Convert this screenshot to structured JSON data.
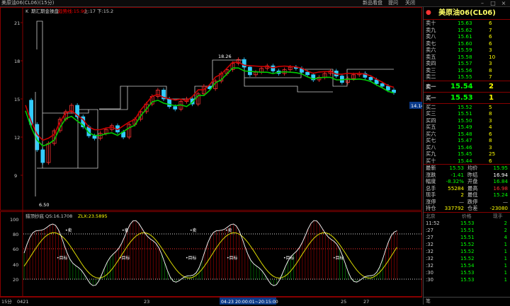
{
  "window": {
    "title": "美原油06(CL06)(15分)",
    "menu": [
      "新品看盘",
      "提问",
      "关闭"
    ]
  },
  "chart_top": {
    "indicator_title": "期汇期金操盘",
    "status_1": "趋势线:15.90",
    "status_2": "上:17 下:15.2",
    "k_label": "K",
    "yticks": [
      "21",
      "18",
      "15",
      "12",
      "9"
    ],
    "high_label": "18.26",
    "low_label": "6.50",
    "price_tag": "14.14"
  },
  "chart_bottom": {
    "indicator_title": "猎顶抄底",
    "qs_label": "QS:16.1708",
    "zlx_label": "ZLX:23.5895",
    "yticks": [
      "100",
      "80",
      "60",
      "40",
      "20"
    ],
    "markers": [
      "•卖",
      "•卖",
      "•卖",
      "•卖",
      "•目标",
      "•目标",
      "•目标",
      "•目标",
      "•目标",
      "•目标"
    ]
  },
  "xaxis": {
    "period": "15分",
    "labels": [
      "0421",
      "23",
      "25",
      "27"
    ],
    "highlight": "04-23 20:00:01~20:15:00"
  },
  "panel": {
    "title": "美原油06(CL06)",
    "asks": [
      {
        "label": "卖十",
        "price": "15.63",
        "vol": "6"
      },
      {
        "label": "卖九",
        "price": "15.62",
        "vol": "7"
      },
      {
        "label": "卖八",
        "price": "15.61",
        "vol": "6"
      },
      {
        "label": "卖七",
        "price": "15.60",
        "vol": "6"
      },
      {
        "label": "卖六",
        "price": "15.59",
        "vol": "3"
      },
      {
        "label": "卖五",
        "price": "15.58",
        "vol": "10"
      },
      {
        "label": "卖四",
        "price": "15.57",
        "vol": "3"
      },
      {
        "label": "卖三",
        "price": "15.56",
        "vol": "8"
      },
      {
        "label": "卖二",
        "price": "15.55",
        "vol": "7"
      }
    ],
    "ask1": {
      "label": "卖一",
      "price": "15.54",
      "vol": "2"
    },
    "bid1": {
      "label": "买一",
      "price": "15.53",
      "vol": "1"
    },
    "bids": [
      {
        "label": "买二",
        "price": "15.52",
        "vol": "5"
      },
      {
        "label": "买三",
        "price": "15.51",
        "vol": "8"
      },
      {
        "label": "买四",
        "price": "15.50",
        "vol": "3"
      },
      {
        "label": "买五",
        "price": "15.49",
        "vol": "4"
      },
      {
        "label": "买六",
        "price": "15.48",
        "vol": "6"
      },
      {
        "label": "买七",
        "price": "15.47",
        "vol": "8"
      },
      {
        "label": "买八",
        "price": "15.46",
        "vol": "3"
      },
      {
        "label": "买九",
        "price": "15.45",
        "vol": "25"
      },
      {
        "label": "买十",
        "price": "15.44",
        "vol": "6"
      }
    ],
    "stats": [
      {
        "l1": "最新",
        "v1": "15.53",
        "l2": "均价",
        "v2": "15.95",
        "c1": "#0f0",
        "c2": "#0f0"
      },
      {
        "l1": "涨跌",
        "v1": "-1.41",
        "l2": "昨结",
        "v2": "16.94",
        "c1": "#0f0",
        "c2": "#fff"
      },
      {
        "l1": "幅度",
        "v1": "-8.32%",
        "l2": "开盘",
        "v2": "16.84",
        "c1": "#0f0",
        "c2": "#0f0"
      },
      {
        "l1": "总手",
        "v1": "55284",
        "l2": "最高",
        "v2": "16.98",
        "c1": "#ff0",
        "c2": "#f33"
      },
      {
        "l1": "现手",
        "v1": "2",
        "l2": "最低",
        "v2": "15.24",
        "c1": "#ff0",
        "c2": "#0f0"
      },
      {
        "l1": "涨停",
        "v1": "—",
        "l2": "跌停",
        "v2": "—",
        "c1": "#ccc",
        "c2": "#ccc"
      },
      {
        "l1": "持仓",
        "v1": "337792",
        "l2": "仓差",
        "v2": "-23080",
        "c1": "#ff0",
        "c2": "#ff0"
      }
    ],
    "tick_header": {
      "time": "北京",
      "price": "价格",
      "vol": "现手"
    },
    "ticks": [
      {
        "time": "11:52",
        "price": "15.53",
        "vol": "2"
      },
      {
        "time": ":27",
        "price": "15.51",
        "vol": "2"
      },
      {
        "time": ":27",
        "price": "15.51",
        "vol": "4"
      },
      {
        "time": ":32",
        "price": "15.52",
        "vol": "1"
      },
      {
        "time": ":32",
        "price": "15.52",
        "vol": "1"
      },
      {
        "time": ":32",
        "price": "15.52",
        "vol": "1"
      },
      {
        "time": ":32",
        "price": "15.54",
        "vol": "1"
      },
      {
        "time": ":30",
        "price": "15.53",
        "vol": "1"
      },
      {
        "time": ":30",
        "price": "15.53",
        "vol": "1"
      }
    ],
    "footer": "笔"
  }
}
